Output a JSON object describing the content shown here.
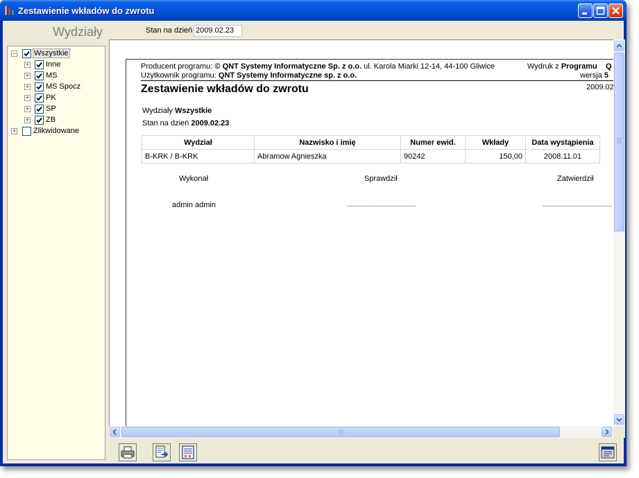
{
  "window": {
    "title": "Zestawienie wkładów do zwrotu",
    "icon": "app-icon"
  },
  "left_panel": {
    "title": "Wydziały",
    "tree": [
      {
        "label": "Wszystkie",
        "checked": true,
        "expanded": true
      },
      {
        "label": "Inne",
        "checked": true
      },
      {
        "label": "MS",
        "checked": true
      },
      {
        "label": "MS Spocz",
        "checked": true
      },
      {
        "label": "PK",
        "checked": true
      },
      {
        "label": "SP",
        "checked": true
      },
      {
        "label": "ZB",
        "checked": true
      },
      {
        "label": "Zlikwidowane",
        "checked": false
      }
    ]
  },
  "filter": {
    "date_label": "Stan na dzień",
    "date_value": "2009.02.23"
  },
  "report": {
    "producer_label": "Producent programu:",
    "producer_name": "© QNT Systemy Informatyczne Sp. z o.o.",
    "producer_address": "ul. Karola Miarki 12-14, 44-100 Gliwice",
    "printout_label": "Wydruk z",
    "printout_value": "Programu",
    "printout_value2": "Q",
    "user_label": "Użytkownik programu:",
    "user_name": "QNT Systemy Informatyczne sp. z o.o.",
    "version_label": "wersja",
    "version_value": "5",
    "title": "Zestawienie wkładów do zwrotu",
    "print_date": "2009.02",
    "dept_label": "Wydziały",
    "dept_value": "Wszystkie",
    "date_label": "Stan na dzień",
    "date_value": "2009.02.23",
    "table": {
      "headers": [
        "Wydział",
        "Nazwisko i imię",
        "Numer ewid.",
        "Wkłady",
        "Data wystąpienia"
      ],
      "rows": [
        [
          "B-KRK / B-KRK",
          "Abramow Agnieszka",
          "90242",
          "150,00",
          "2008.11.01"
        ]
      ]
    },
    "signatures": {
      "performed": "Wykonał",
      "checked": "Sprawdził",
      "approved": "Zatwierdził",
      "performer_name": "admin admin",
      "checked_line": "........................................",
      "approved_line": "........................................"
    }
  },
  "toolbar": {
    "buttons": [
      "print-icon",
      "export-icon",
      "page-setup-icon",
      "close-preview-icon"
    ]
  },
  "colors": {
    "titlebar": "#0353d6",
    "tree_background": "#fdfde8",
    "dialog_background": "#ece9d8"
  }
}
